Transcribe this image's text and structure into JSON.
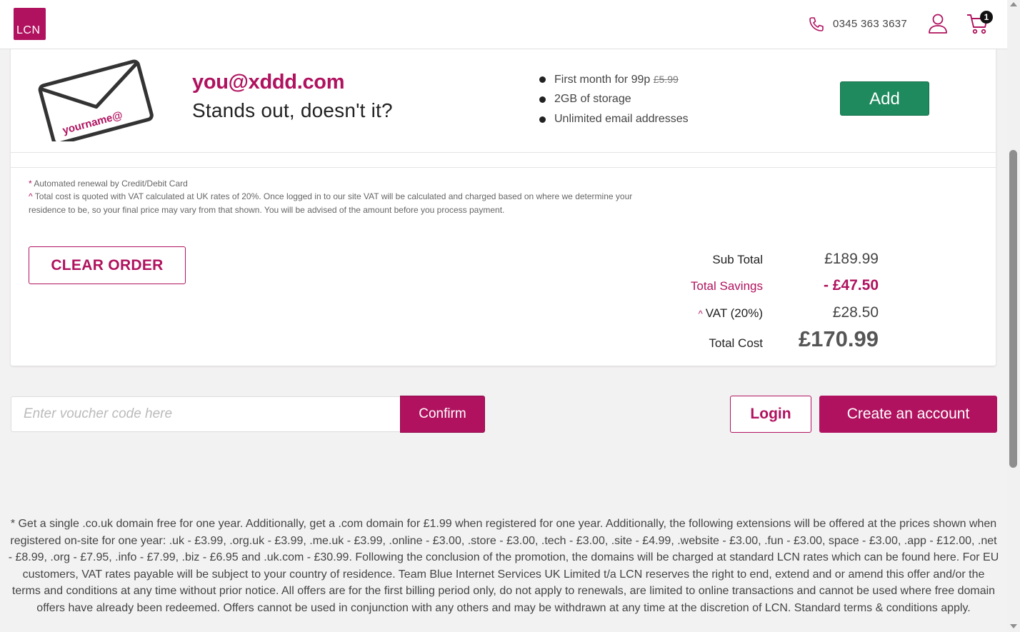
{
  "header": {
    "logo_text": "LCN",
    "phone": "0345 363 3637",
    "cart_count": "1"
  },
  "promo": {
    "envelope_text": "yourname@",
    "email": "you@xddd.com",
    "tagline": "Stands out, doesn't it?",
    "features": [
      {
        "text": "First month for 99p",
        "strike": "£5.99"
      },
      {
        "text": "2GB of storage"
      },
      {
        "text": "Unlimited email addresses"
      }
    ],
    "add_label": "Add"
  },
  "notes": {
    "note1_mark": "*",
    "note1": "Automated renewal by Credit/Debit Card",
    "note2_mark": "^",
    "note2": "Total cost is quoted with VAT calculated at UK rates of 20%. Once logged in to our site VAT will be calculated and charged based on where we determine your residence to be, so your final price may vary from that shown. You will be advised of the amount before you process payment."
  },
  "order": {
    "clear_label": "CLEAR ORDER",
    "subtotal_label": "Sub Total",
    "subtotal": "£189.99",
    "savings_label": "Total Savings",
    "savings": "- £47.50",
    "vat_mark": "^",
    "vat_label": "VAT (20%)",
    "vat": "£28.50",
    "total_label": "Total Cost",
    "total": "£170.99"
  },
  "voucher": {
    "placeholder": "Enter voucher code here",
    "confirm_label": "Confirm"
  },
  "account": {
    "login_label": "Login",
    "create_label": "Create an account"
  },
  "terms": "* Get a single .co.uk domain free for one year. Additionally, get a .com domain for £1.99 when registered for one year. Additionally, the following extensions will be offered at the prices shown when registered on-site for one year: .uk - £3.99, .org.uk - £3.99, .me.uk - £3.99, .online - £3.00, .store - £3.00, .tech - £3.00, .site - £4.99, .website - £3.00, .fun - £3.00, space - £3.00, .app - £12.00, .net - £8.99, .org - £7.95, .info - £7.99, .biz - £6.95  and .uk.com - £30.99. Following the conclusion of the promotion, the domains will be charged at standard LCN rates which can be found here. For EU customers, VAT rates payable will be subject to your country of residence. Team Blue Internet Services UK Limited t/a LCN reserves the right to end, extend and or amend this offer and/or the terms and conditions at any time without prior notice. All offers are for the first billing period only, do not apply to renewals, are limited to online transactions and cannot be used where free domain offers have already been redeemed. Offers cannot be used in conjunction with any others and may be withdrawn at any time at the discretion of LCN. Standard terms & conditions apply."
}
